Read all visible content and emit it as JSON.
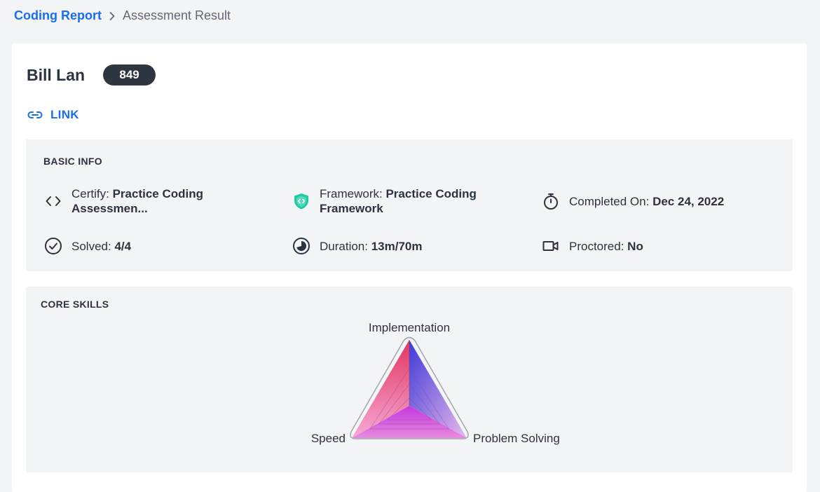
{
  "breadcrumb": {
    "root": "Coding Report",
    "current": "Assessment Result"
  },
  "candidate": {
    "name": "Bill Lan",
    "score": "849"
  },
  "link": {
    "label": "LINK"
  },
  "basic_info": {
    "title": "BASIC INFO",
    "certify": {
      "label": "Certify:",
      "value": "Practice Coding Assessmen..."
    },
    "framework": {
      "label": "Framework:",
      "value": "Practice Coding Framework"
    },
    "completed": {
      "label": "Completed On:",
      "value": "Dec 24, 2022"
    },
    "solved": {
      "label": "Solved:",
      "value": "4/4"
    },
    "duration": {
      "label": "Duration:",
      "value": "13m/70m"
    },
    "proctored": {
      "label": "Proctored:",
      "value": "No"
    }
  },
  "core_skills": {
    "title": "CORE SKILLS",
    "axes": [
      "Implementation",
      "Problem Solving",
      "Speed"
    ]
  },
  "colors": {
    "accent": "#1a6df0",
    "badge": "#2e3640",
    "framework_icon": "#1ec9a3"
  },
  "icons": [
    "chevron-right-icon",
    "link-icon",
    "code-icon",
    "shield-icon",
    "stopwatch-icon",
    "check-circle-icon",
    "pie-timer-icon",
    "video-camera-icon"
  ]
}
